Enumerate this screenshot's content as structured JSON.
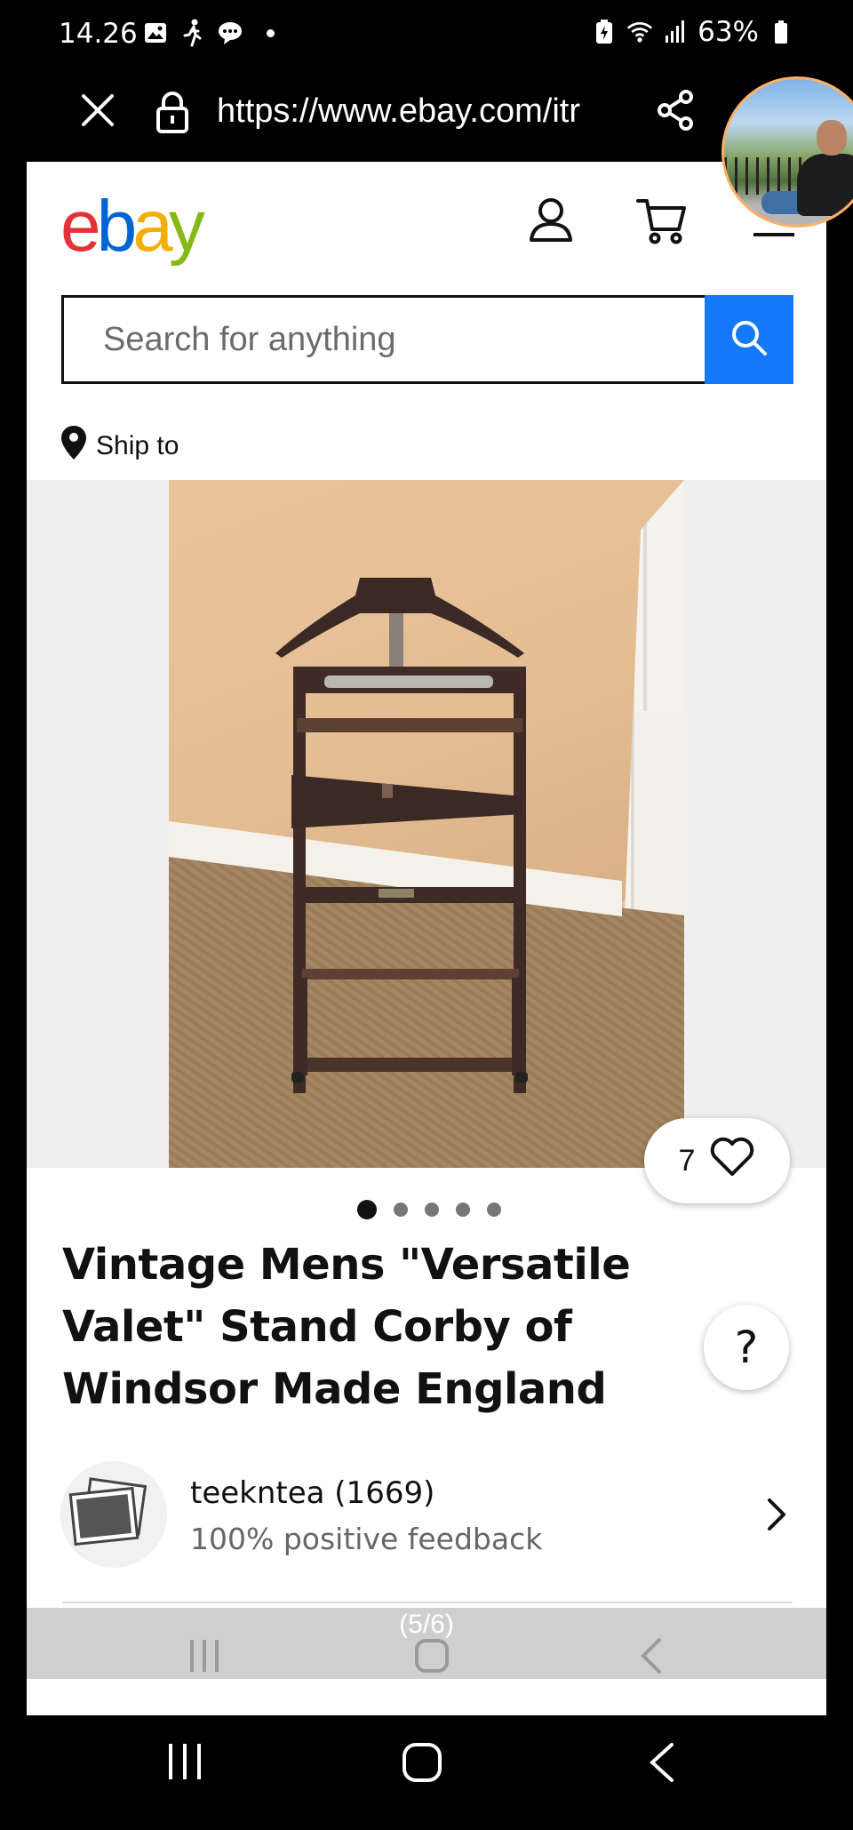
{
  "status_bar": {
    "time": "14.26",
    "battery": "63%",
    "icons": [
      "gallery-icon",
      "walking-icon",
      "chat-bubble-icon",
      "battery-saver-icon",
      "wifi-icon",
      "signal-icon",
      "battery-icon"
    ]
  },
  "browser": {
    "url": "https://www.ebay.com/itr"
  },
  "header": {
    "logo": {
      "e": "e",
      "b": "b",
      "a": "a",
      "y": "y"
    }
  },
  "search": {
    "placeholder": "Search for anything"
  },
  "ship_to": {
    "label": "Ship to"
  },
  "gallery": {
    "watch_count": "7",
    "image_count": 5,
    "active_index": 0
  },
  "listing": {
    "title": "Vintage Mens \"Versatile Valet\" Stand Corby of Windsor Made England"
  },
  "help": {
    "label": "?"
  },
  "seller": {
    "name": "teekntea (1669)",
    "feedback": "100% positive feedback"
  },
  "overlay": {
    "counter": "(5/6)"
  },
  "colors": {
    "search_button": "#1479fb",
    "ebay_red": "#e53238",
    "ebay_blue": "#0064d2",
    "ebay_yellow": "#f5af02",
    "ebay_green": "#86b817"
  }
}
